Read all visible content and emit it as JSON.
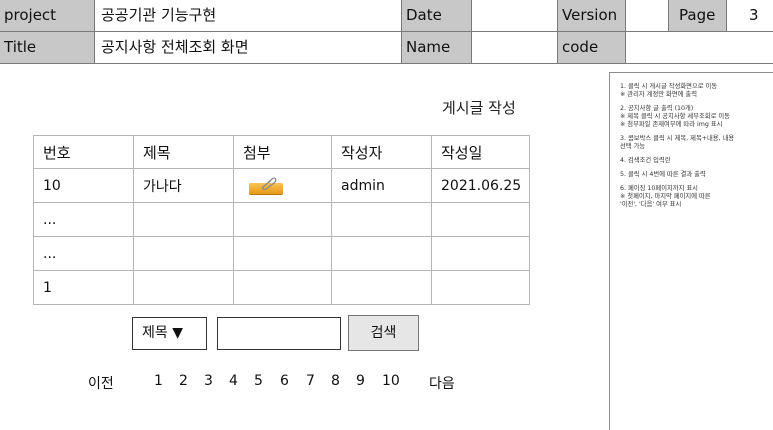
{
  "header": {
    "project_label": "project",
    "project_value": "공공기관 기능구현",
    "date_label": "Date",
    "date_value": "",
    "version_label": "Version",
    "version_value": "",
    "page_label": "Page",
    "page_value": "3",
    "title_label": "Title",
    "title_value": "공지사항 전체조회 화면",
    "name_label": "Name",
    "name_value": "",
    "code_label": "code",
    "code_value": ""
  },
  "main": {
    "write_link": "게시글 작성",
    "columns": [
      "번호",
      "제목",
      "첨부",
      "작성자",
      "작성일"
    ],
    "rows": [
      [
        "10",
        "가나다",
        "",
        "admin",
        "2021.06.25"
      ],
      [
        "...",
        "",
        "",
        "",
        ""
      ],
      [
        "...",
        "",
        "",
        "",
        ""
      ],
      [
        "1",
        "",
        "",
        "",
        ""
      ]
    ],
    "attachment_icon": "paperclip-icon"
  },
  "search": {
    "select_value": "제목 ▼",
    "input_value": "",
    "button_label": "검색"
  },
  "pagination": {
    "prev": "이전",
    "pages": [
      "1",
      "2",
      "3",
      "4",
      "5",
      "6",
      "7",
      "8",
      "9",
      "10"
    ],
    "next": "다음"
  },
  "notes": [
    "1. 클릭 시 게시글 작성화면으로 이동\n※ 관리자 계정만 화면에 출력",
    "2. 공지사항 글 출력 (10개)\n※ 제목 클릭 시 공지사항 세부조회로 이동\n※ 첨부파일 존재여부에 따라 img 표시",
    "3. 콤보박스 클릭 시 제목, 제목+내용, 내용\n    선택 가능",
    "4. 검색조건 입력란",
    "5. 클릭 시 4번에 따른 결과 출력",
    "6. 페이징 10페이지까지 표시\n※ 첫페이지, 마지막 페이지에 따른\n    '이전', '다음' 여부 표시"
  ],
  "colors": {
    "header_gray": "#c8c8c8",
    "border": "#b5b5b5",
    "attachment_orange": "#f0a628"
  }
}
